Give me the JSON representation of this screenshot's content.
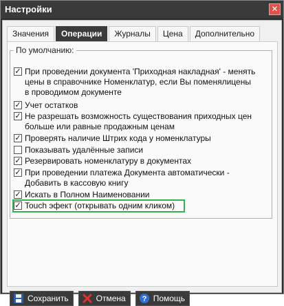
{
  "window": {
    "title": "Настройки"
  },
  "tabs": [
    {
      "label": "Значения",
      "active": false
    },
    {
      "label": "Операции",
      "active": true
    },
    {
      "label": "Журналы",
      "active": false
    },
    {
      "label": "Цена",
      "active": false
    },
    {
      "label": "Дополнительно",
      "active": false
    }
  ],
  "defaults": {
    "legend": "По умолчанию:",
    "options": [
      {
        "label": "При проведении документа 'Приходная накладная' - менять цены в справочнике Номенклатур, если Вы поменялицены в проводимом документе",
        "checked": true
      },
      {
        "label": "Учет остатков",
        "checked": true
      },
      {
        "label": "Не разрешать возможность существования приходных цен больше или равные продажным ценам",
        "checked": true
      },
      {
        "label": "Проверять наличие Штрих кода у номенклатуры",
        "checked": true
      },
      {
        "label": "Показывать удалённые записи",
        "checked": false
      },
      {
        "label": "Резервировать номенклатуру в документах",
        "checked": true
      },
      {
        "label": "При проведении платежа Документа автоматически - Добавить в кассовую книгу",
        "checked": true
      },
      {
        "label": "Искать в Полном Наименовании",
        "checked": true
      },
      {
        "label": "Touch эфект (открывать одним кликом)",
        "checked": true
      }
    ]
  },
  "buttons": {
    "save": "Сохранить",
    "cancel": "Отмена",
    "help": "Помощь"
  },
  "icons": {
    "save": "floppy-disk-icon",
    "cancel": "red-x-icon",
    "help": "question-mark-icon"
  },
  "colors": {
    "highlight": "#35b04a",
    "titlebar": "#3a3a3a"
  }
}
